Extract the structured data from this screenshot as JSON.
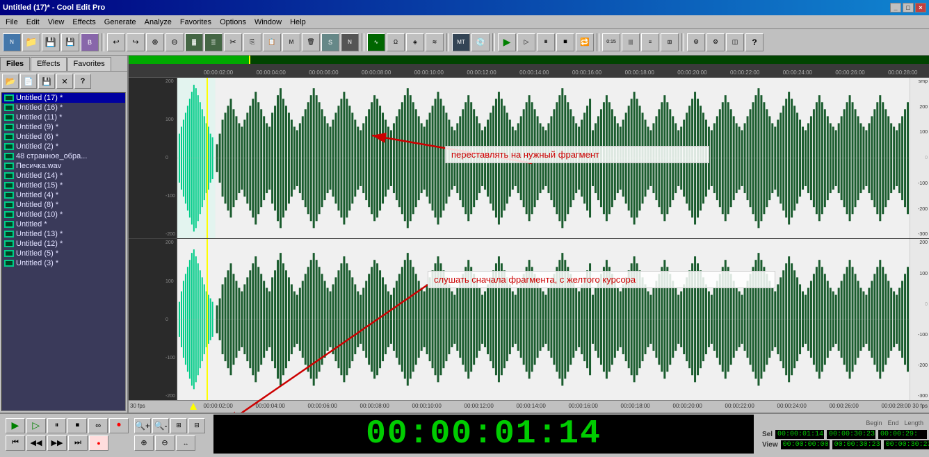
{
  "titlebar": {
    "title": "Untitled (17)* - Cool Edit Pro",
    "controls": [
      "_",
      "□",
      "×"
    ]
  },
  "menubar": {
    "items": [
      "File",
      "Edit",
      "View",
      "Effects",
      "Generate",
      "Analyze",
      "Favorites",
      "Options",
      "Window",
      "Help"
    ]
  },
  "tabs": {
    "items": [
      "Files",
      "Effects",
      "Favorites"
    ],
    "active": "Files"
  },
  "sidebar": {
    "toolbar_buttons": [
      "open",
      "new",
      "save",
      "close",
      "help"
    ],
    "files": [
      {
        "name": "Untitled (17) *",
        "selected": true
      },
      {
        "name": "Untitled (16) *",
        "selected": false
      },
      {
        "name": "Untitled (11) *",
        "selected": false
      },
      {
        "name": "Untitled (9) *",
        "selected": false
      },
      {
        "name": "Untitled (6) *",
        "selected": false
      },
      {
        "name": "Untitled (2) *",
        "selected": false
      },
      {
        "name": "48 странное_обра...",
        "selected": false
      },
      {
        "name": "Песичка.wav",
        "selected": false
      },
      {
        "name": "Untitled (14) *",
        "selected": false
      },
      {
        "name": "Untitled (15) *",
        "selected": false
      },
      {
        "name": "Untitled (4) *",
        "selected": false
      },
      {
        "name": "Untitled (8) *",
        "selected": false
      },
      {
        "name": "Untitled (10) *",
        "selected": false
      },
      {
        "name": "Untitled *",
        "selected": false
      },
      {
        "name": "Untitled (13) *",
        "selected": false
      },
      {
        "name": "Untitled (12) *",
        "selected": false
      },
      {
        "name": "Untitled (5) *",
        "selected": false
      },
      {
        "name": "Untitled (3) *",
        "selected": false
      }
    ]
  },
  "annotations": {
    "top_text": "переставлять на нужный фрагмент",
    "bottom_text": "слушать сначала фрагмента, с желтого курсора"
  },
  "timeline_labels": [
    "00:00:02:00",
    "00:00:04:00",
    "00:00:06:00",
    "00:00:08:00",
    "00:00:10:00",
    "00:00:12:00",
    "00:00:14:00",
    "00:00:16:00",
    "00:00:18:00",
    "00:00:20:00",
    "00:00:22:00",
    "00:00:24:00",
    "00:00:26:00",
    "00:00:28:00"
  ],
  "scale_right_top": [
    "smp",
    "200",
    "100",
    "-100",
    "-200",
    "-300"
  ],
  "scale_right_bottom": [
    "200",
    "100",
    "-100",
    "-200",
    "-300"
  ],
  "transport": {
    "timecode": "00:00:01:14",
    "sel_label": "Sel",
    "view_label": "View",
    "sel_begin": "00:00:01:14",
    "sel_end": "00:00:30:23",
    "sel_length": "00:00:29:",
    "view_begin": "00:00:00:00",
    "view_end": "00:00:30:23",
    "fps_left": "30 fps",
    "fps_right": "30 fps"
  },
  "colors": {
    "waveform_dark": "#1a5c2e",
    "waveform_light": "#00cc88",
    "background_wave": "#f0f0f8",
    "cursor_yellow": "#ffff00",
    "annotation_red": "#cc0000",
    "timecode_green": "#00cc00"
  }
}
